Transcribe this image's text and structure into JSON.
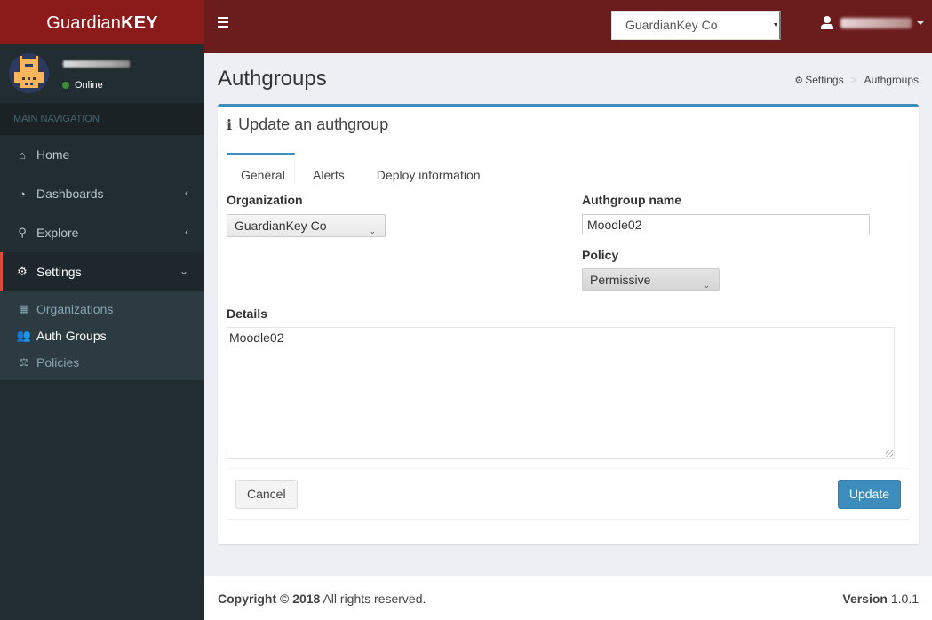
{
  "brand": {
    "name_regular": "Guardian",
    "name_bold": "KEY",
    "primary_color": "#8b1a1a",
    "navbar_color": "#6b1c1c"
  },
  "navbar": {
    "menu_icon": "hamburger-icon",
    "org_select": {
      "value": "GuardianKey Co"
    },
    "user": {
      "icon": "user-icon",
      "name_initial": "F"
    }
  },
  "sidebar": {
    "user_panel": {
      "status": "Online",
      "status_color": "#3c8d3c"
    },
    "nav_header": "MAIN NAVIGATION",
    "items": [
      {
        "label": "Home",
        "icon": "home-icon",
        "glyph": "⌂",
        "chevron": ""
      },
      {
        "label": "Dashboards",
        "icon": "dashboard-icon",
        "glyph": "◔",
        "chevron": "‹"
      },
      {
        "label": "Explore",
        "icon": "search-icon",
        "glyph": "⚲",
        "chevron": "‹"
      },
      {
        "label": "Settings",
        "icon": "gears-icon",
        "glyph": "⚙",
        "chevron": "⌄",
        "active": true
      }
    ],
    "submenu": [
      {
        "label": "Organizations",
        "icon": "building-icon",
        "glyph": "▦"
      },
      {
        "label": "Auth Groups",
        "icon": "users-icon",
        "glyph": "👥",
        "current": true
      },
      {
        "label": "Policies",
        "icon": "balance-scale-icon",
        "glyph": "⚖"
      }
    ]
  },
  "page": {
    "title": "Authgroups",
    "breadcrumb": [
      {
        "label": "Settings",
        "icon": "gears-icon"
      },
      {
        "label": "Authgroups"
      }
    ],
    "breadcrumb_separator": ">"
  },
  "box": {
    "title": "Update an authgroup",
    "title_icon": "info-icon",
    "accent_color": "#3c8dbc",
    "tabs": [
      {
        "label": "General",
        "active": true
      },
      {
        "label": "Alerts"
      },
      {
        "label": "Deploy information"
      }
    ],
    "form": {
      "organization": {
        "label": "Organization",
        "value": "GuardianKey Co"
      },
      "authgroup_name": {
        "label": "Authgroup name",
        "value": "Moodle02"
      },
      "policy": {
        "label": "Policy",
        "value": "Permissive"
      },
      "details": {
        "label": "Details",
        "value": "Moodle02"
      }
    },
    "buttons": {
      "cancel": "Cancel",
      "update": "Update"
    }
  },
  "footer": {
    "copyright_bold": "Copyright © 2018",
    "copyright_rest": " All rights reserved.",
    "version_label": "Version",
    "version_value": " 1.0.1"
  }
}
